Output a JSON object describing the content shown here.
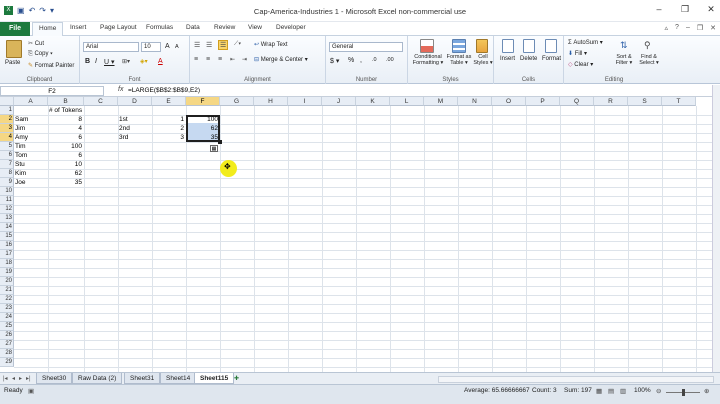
{
  "window": {
    "title": "Cap-America-Industries 1 - Microsoft Excel non-commercial use"
  },
  "tabs": [
    "File",
    "Home",
    "Insert",
    "Page Layout",
    "Formulas",
    "Data",
    "Review",
    "View",
    "Developer"
  ],
  "ribbon": {
    "clipboard": {
      "paste": "Paste",
      "cut": "Cut",
      "copy": "Copy ▾",
      "painter": "Format Painter",
      "label": "Clipboard"
    },
    "font": {
      "name": "Arial",
      "size": "10",
      "label": "Font",
      "bold": "B",
      "italic": "I",
      "underline": "U ▾",
      "grow": "A",
      "shrink": "A",
      "color_a": "A"
    },
    "alignment": {
      "wrap": "Wrap Text",
      "merge": "Merge & Center ▾",
      "label": "Alignment"
    },
    "number": {
      "format": "General",
      "currency": "$ ▾",
      "percent": "%",
      "comma": ",",
      "inc": ".0",
      ".00": ".00",
      "label": "Number"
    },
    "styles": {
      "conditional": "Conditional Formatting ▾",
      "table": "Format as Table ▾",
      "cell": "Cell Styles ▾",
      "label": "Styles"
    },
    "cells": {
      "insert": "Insert",
      "delete": "Delete",
      "format": "Format",
      "label": "Cells"
    },
    "editing": {
      "autosum": "AutoSum ▾",
      "fill": "Fill ▾",
      "clear": "Clear ▾",
      "sort": "Sort & Filter ▾",
      "find": "Find & Select ▾",
      "label": "Editing"
    }
  },
  "formula_bar": {
    "name_box": "F2",
    "fx": "fx",
    "formula": "=LARGE($B$2:$B$9,E2)"
  },
  "columns": [
    "A",
    "B",
    "C",
    "D",
    "E",
    "F",
    "G",
    "H",
    "I",
    "J",
    "K",
    "L",
    "M",
    "N",
    "O",
    "P",
    "Q",
    "R",
    "S",
    "T"
  ],
  "rows": [
    "1",
    "2",
    "3",
    "4",
    "5",
    "6",
    "7",
    "8",
    "9",
    "10",
    "11",
    "12",
    "13",
    "14",
    "15",
    "16",
    "17",
    "18",
    "19",
    "20",
    "21",
    "22",
    "23",
    "24",
    "25",
    "26",
    "27",
    "28",
    "29"
  ],
  "cells": {
    "B1": "# of Tokens",
    "A2": "Sam",
    "B2": "8",
    "A3": "Jim",
    "B3": "4",
    "A4": "Amy",
    "B4": "6",
    "A5": "Tim",
    "B5": "100",
    "A6": "Tom",
    "B6": "6",
    "A7": "Stu",
    "B7": "10",
    "A8": "Kim",
    "B8": "62",
    "A9": "Joe",
    "B9": "35",
    "D2": "1st",
    "D3": "2nd",
    "D4": "3rd",
    "E2": "1",
    "E3": "2",
    "E4": "3",
    "F2": "100",
    "F3": "62",
    "F4": "35"
  },
  "sheets": [
    "Sheet30",
    "Raw Data (2)",
    "Sheet31",
    "Sheet14",
    "Sheet115"
  ],
  "active_sheet": "Sheet115",
  "status": {
    "ready": "Ready",
    "average": "Average: 65.66666667",
    "count": "Count: 3",
    "sum": "Sum: 197",
    "zoom": "100%"
  }
}
